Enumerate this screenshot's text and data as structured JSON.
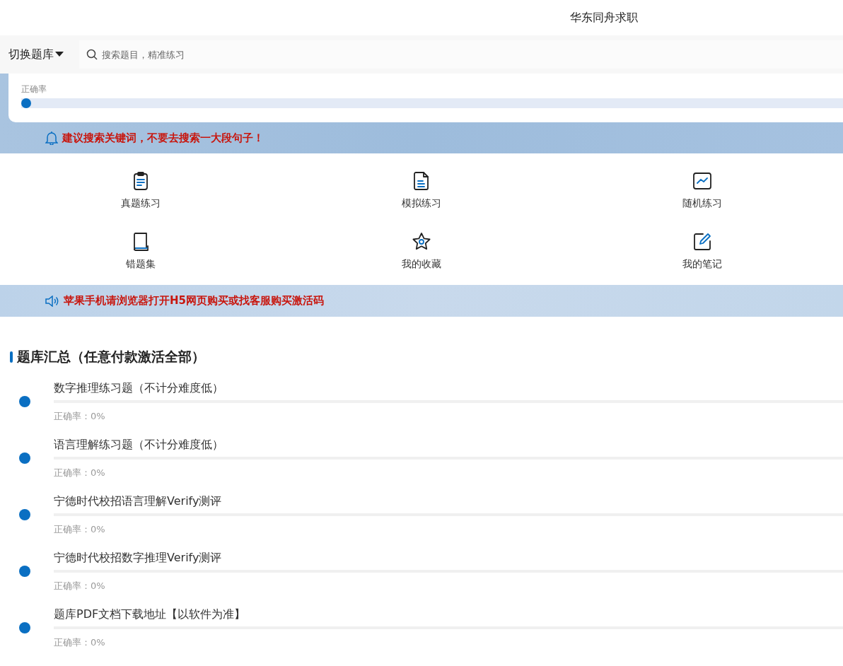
{
  "header": {
    "title": "华东同舟求职"
  },
  "toolbar": {
    "switch_label": "切换题库",
    "search": {
      "placeholder": "搜索题目，精准练习"
    }
  },
  "accuracy": {
    "label": "正确率",
    "level": 0
  },
  "notice_top": {
    "text": "建议搜索关键词，不要去搜索一大段句子！"
  },
  "menu": [
    {
      "kind": "clipboard",
      "label": "真题练习"
    },
    {
      "kind": "document",
      "label": "模拟练习"
    },
    {
      "kind": "chart",
      "label": "随机练习"
    },
    {
      "kind": "book",
      "label": "错题集"
    },
    {
      "kind": "star",
      "label": "我的收藏"
    },
    {
      "kind": "edit",
      "label": "我的笔记"
    }
  ],
  "notice_bottom": {
    "text": "苹果手机请浏览器打开H5网页购买或找客服购买激活码"
  },
  "section": {
    "title": "题库汇总（任意付款激活全部）"
  },
  "banks": [
    {
      "title": "数字推理练习题（不计分难度低）",
      "level": 0,
      "accuracy": "正确率：0%"
    },
    {
      "title": "语言理解练习题（不计分难度低）",
      "level": 0,
      "accuracy": "正确率：0%"
    },
    {
      "title": "宁德时代校招语言理解Verify测评",
      "level": 0,
      "accuracy": "正确率：0%"
    },
    {
      "title": "宁德时代校招数字推理Verify测评",
      "level": 0,
      "accuracy": "正确率：0%"
    },
    {
      "title": "题库PDF文档下载地址【以软件为准】",
      "level": 0,
      "accuracy": "正确率：0%"
    }
  ]
}
